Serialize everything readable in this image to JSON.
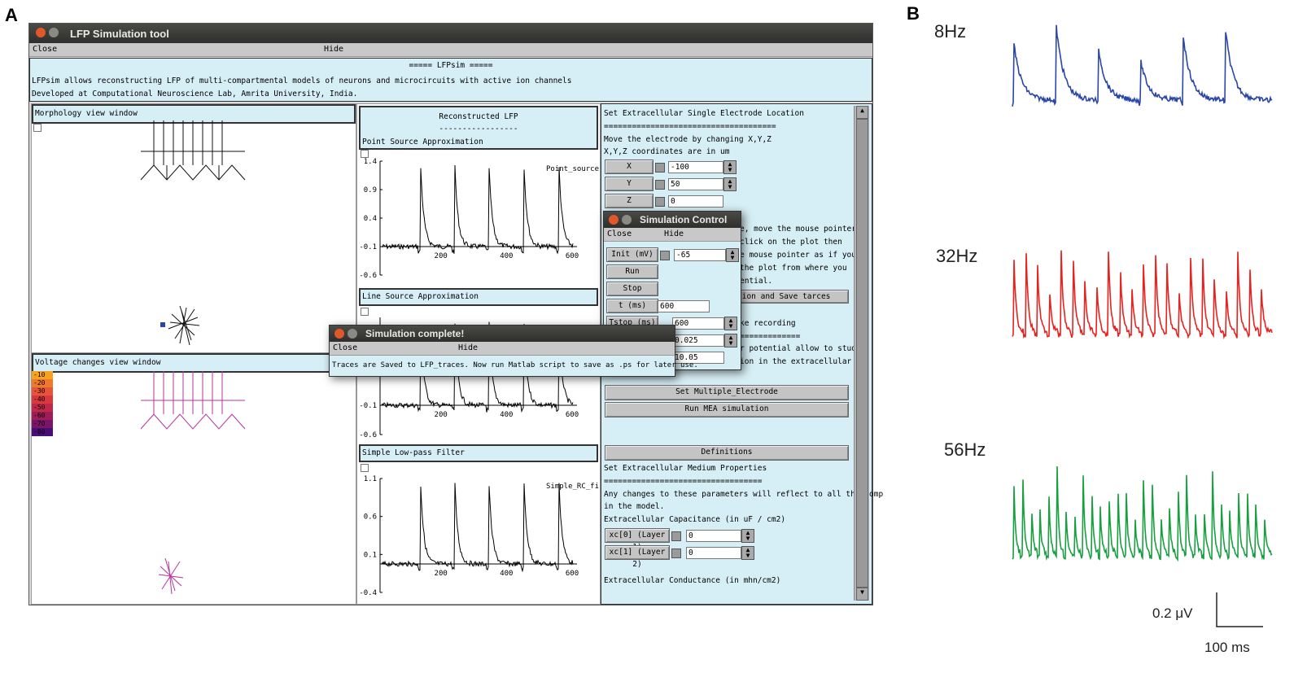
{
  "panels": {
    "a": "A",
    "b": "B"
  },
  "window": {
    "title": "LFP Simulation tool",
    "menu_close": "Close",
    "menu_hide": "Hide"
  },
  "info": {
    "heading": "===== LFPsim =====",
    "line1": "LFPsim allows reconstructing LFP of multi-compartmental models of neurons and microcircuits with active ion channels",
    "line2": "Developed at Computational Neuroscience Lab, Amrita University, India."
  },
  "morphology": {
    "title": "Morphology view window"
  },
  "voltage": {
    "title": "Voltage changes view window",
    "legend": [
      "-10",
      "-20",
      "-30",
      "-40",
      "-50",
      "-60",
      "-70",
      "-80"
    ],
    "legend_colors": [
      "#f7a21c",
      "#f0782a",
      "#e8543a",
      "#d8383e",
      "#c0284a",
      "#a01c58",
      "#7a1468",
      "#4a0c78"
    ]
  },
  "lfp": {
    "title": "Reconstructed LFP",
    "dashes": "-----------------",
    "plots": [
      {
        "title": "Point Source Approximation",
        "series": "Point_source",
        "yticks": [
          "1.4",
          "0.9",
          "0.4",
          "-0.1",
          "-0.6"
        ],
        "xticks": [
          "200",
          "400",
          "600"
        ]
      },
      {
        "title": "Line Source Approximation",
        "series": "",
        "yticks": [
          "-0.1",
          "-0.6"
        ],
        "xticks": [
          "200",
          "400",
          "600"
        ]
      },
      {
        "title": "Simple Low-pass Filter",
        "series": "Simple_RC_fi",
        "yticks": [
          "1.1",
          "0.6",
          "0.1",
          "-0.4"
        ],
        "xticks": [
          "200",
          "400",
          "600"
        ]
      }
    ]
  },
  "electrode": {
    "title": "Set Extracellular Single Electrode Location",
    "sep": "=====================================",
    "line1": "Move the electrode by changing X,Y,Z",
    "line2": "X,Y,Z coordinates are in um",
    "coords": [
      {
        "label": "X",
        "value": "-100"
      },
      {
        "label": "Y",
        "value": "50"
      },
      {
        "label": "Z",
        "value": "0"
      }
    ],
    "partial": [
      "e, move the mouse pointer o",
      " click on the plot then",
      "e mouse pointer as if you",
      "the plot from where you",
      "ential."
    ],
    "save_partial": "cion and Save tarces",
    "rec_partial": "ke recording",
    "rec_sep": "=============",
    "rec1": "r potential allow to study",
    "rec2": "ion in the extracellular m",
    "multi_btn": "Set Multiple_Electrode",
    "mea_btn": "Run MEA simulation",
    "defs_btn": "Definitions",
    "medium_title": "Set Extracellular Medium Properties",
    "medium_sep": "==================================",
    "medium1": "Any changes to these parameters will reflect to all the comp",
    "medium2": "in the model.",
    "cap_title": "Extracellular Capacitance (in uF / cm2)",
    "xc": [
      {
        "label": "xc[0] (Layer 1)",
        "value": "0"
      },
      {
        "label": "xc[1] (Layer 2)",
        "value": "0"
      }
    ],
    "cond_title": "Extracellular Conductance (in mhn/cm2)"
  },
  "sim_control": {
    "title": "Simulation Control",
    "close": "Close",
    "hide": "Hide",
    "init_label": "Init (mV) ↵",
    "init_value": "-65",
    "run": "Run",
    "stop": "Stop",
    "t_label": "t (ms)",
    "t_value": "600",
    "tstop_label": "Tstop (ms)",
    "tstop_value": "600",
    "dt_value": "0.025",
    "extra_value": "10.05"
  },
  "complete": {
    "title": "Simulation complete!",
    "close": "Close",
    "hide": "Hide",
    "message": "Traces are Saved to LFP_traces. Now run Matlab script to save as .ps for later use."
  },
  "traces": [
    {
      "label": "8Hz",
      "color": "#2a46a8"
    },
    {
      "label": "32Hz",
      "color": "#e8221e"
    },
    {
      "label": "56Hz",
      "color": "#18a040"
    }
  ],
  "scalebar": {
    "v": "0.2 μV",
    "t": "100 ms"
  }
}
